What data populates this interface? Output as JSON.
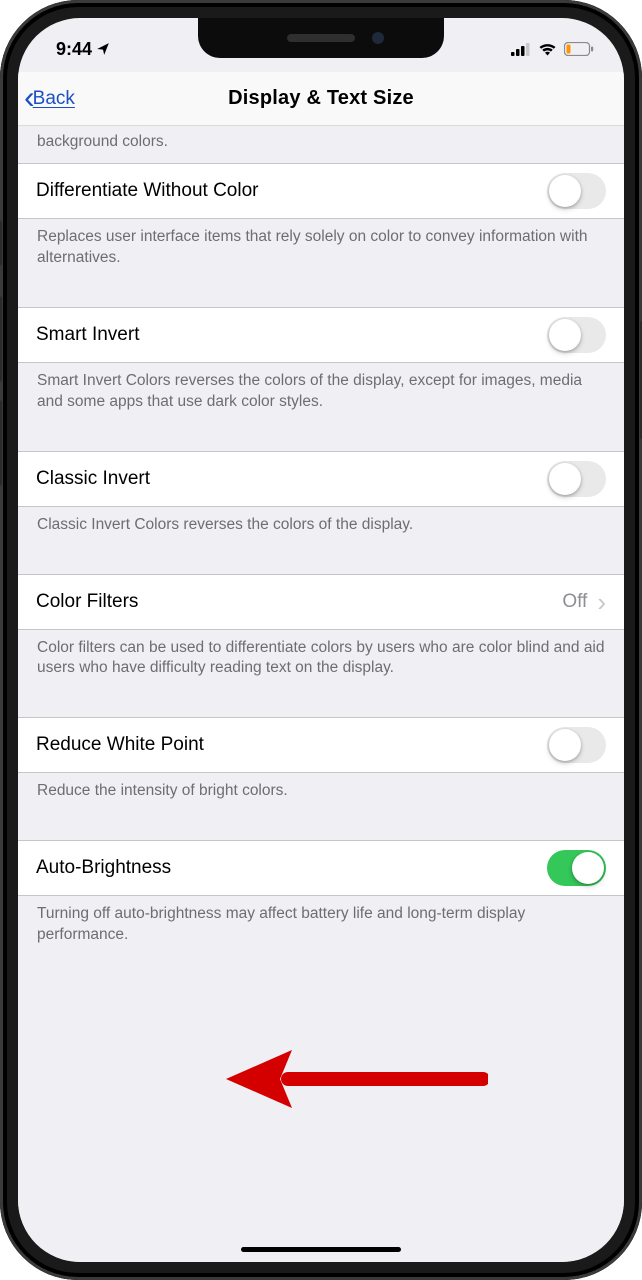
{
  "status": {
    "time": "9:44",
    "location_icon": "location-arrow-icon",
    "signal_bars": 4,
    "wifi_bars": 3,
    "battery_level": "low",
    "battery_color": "#ff9500"
  },
  "nav": {
    "back_label": "Back",
    "title": "Display & Text Size"
  },
  "truncated_footer": "background colors.",
  "rows": {
    "differentiate": {
      "label": "Differentiate Without Color",
      "on": false,
      "footer": "Replaces user interface items that rely solely on color to convey information with alternatives."
    },
    "smart_invert": {
      "label": "Smart Invert",
      "on": false,
      "footer": "Smart Invert Colors reverses the colors of the display, except for images, media and some apps that use dark color styles."
    },
    "classic_invert": {
      "label": "Classic Invert",
      "on": false,
      "footer": "Classic Invert Colors reverses the colors of the display."
    },
    "color_filters": {
      "label": "Color Filters",
      "value": "Off",
      "footer": "Color filters can be used to differentiate colors by users who are color blind and aid users who have difficulty reading text on the display."
    },
    "reduce_white_point": {
      "label": "Reduce White Point",
      "on": false,
      "footer": "Reduce the intensity of bright colors."
    },
    "auto_brightness": {
      "label": "Auto-Brightness",
      "on": true,
      "footer": "Turning off auto-brightness may affect battery life and long-term display performance."
    }
  }
}
